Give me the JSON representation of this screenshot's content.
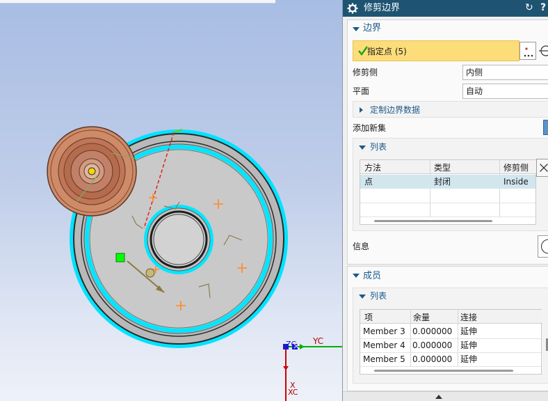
{
  "viewport": {
    "axis_yc": "YC",
    "axis_zc": "ZC",
    "axis_x": "X",
    "axis_xc": "XC",
    "colors": {
      "background_top": "#a8bde4",
      "part_gray": "#bcbcbc",
      "boundary_cyan": "#00e6ff",
      "tool_copper": "#c98563",
      "point_marker": "#ff8a22",
      "selection_green": "#00ff00"
    }
  },
  "dialog": {
    "title": "修剪边界",
    "title_icon": "gear-icon",
    "reset_icon": "reset-icon",
    "help_label": "?",
    "boundary": {
      "title": "边界",
      "specify_points": "指定点 (5)",
      "trim_side_label": "修剪侧",
      "trim_side_value": "内侧",
      "plane_label": "平面",
      "plane_value": "自动",
      "custom_data": "定制边界数据",
      "add_new_set": "添加新集",
      "list": {
        "title": "列表",
        "columns": [
          "方法",
          "类型",
          "修剪侧"
        ],
        "rows": [
          {
            "method": "点",
            "type": "封闭",
            "trim_side": "Inside"
          }
        ]
      },
      "info": "信息"
    },
    "members": {
      "title": "成员",
      "list": {
        "title": "列表",
        "columns": [
          "项",
          "余量",
          "连接"
        ],
        "rows": [
          {
            "item": "Member 3",
            "stock": "0.000000",
            "connect": "延伸"
          },
          {
            "item": "Member 4",
            "stock": "0.000000",
            "connect": "延伸"
          },
          {
            "item": "Member 5",
            "stock": "0.000000",
            "connect": "延伸"
          }
        ]
      }
    }
  }
}
